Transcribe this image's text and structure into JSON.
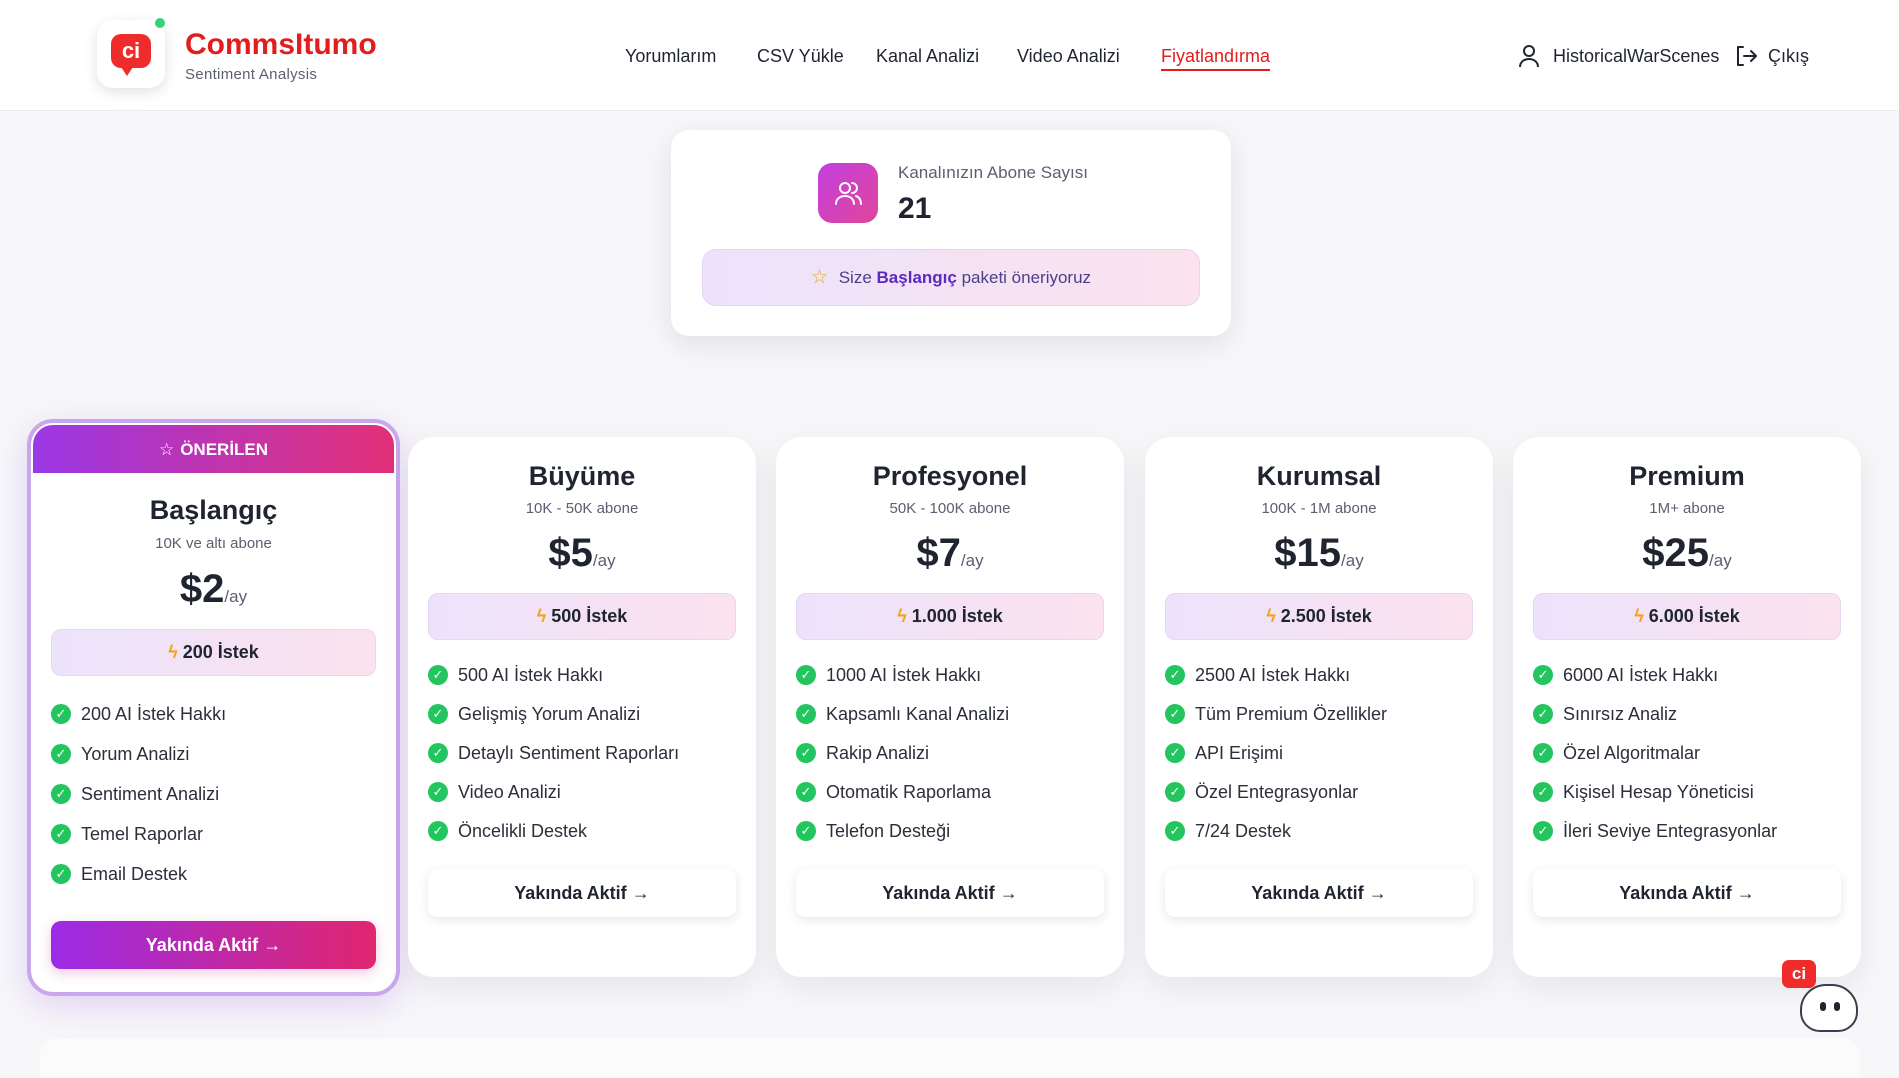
{
  "header": {
    "brand": "CommsItumo",
    "tagline": "Sentiment Analysis",
    "logo_text": "ci",
    "nav": [
      {
        "label": "Yorumlarım"
      },
      {
        "label": "CSV Yükle"
      },
      {
        "label": "Kanal Analizi"
      },
      {
        "label": "Video Analizi"
      },
      {
        "label": "Fiyatlandırma",
        "active": true
      }
    ],
    "user_name": "HistoricalWarScenes",
    "logout_label": "Çıkış"
  },
  "subscriber": {
    "label": "Kanalınızın Abone Sayısı",
    "count": "21",
    "recommend_prefix": "Size",
    "recommend_plan": "Başlangıç",
    "recommend_suffix": "paketi öneriyoruz"
  },
  "plans": [
    {
      "badge": "ÖNERİLEN",
      "name": "Başlangıç",
      "range": "10K ve altı abone",
      "price": "$2",
      "period": "/ay",
      "requests": "200 İstek",
      "features": [
        "200 AI İstek Hakkı",
        "Yorum Analizi",
        "Sentiment Analizi",
        "Temel Raporlar",
        "Email Destek"
      ],
      "cta": "Yakında Aktif"
    },
    {
      "name": "Büyüme",
      "range": "10K - 50K abone",
      "price": "$5",
      "period": "/ay",
      "requests": "500 İstek",
      "features": [
        "500 AI İstek Hakkı",
        "Gelişmiş Yorum Analizi",
        "Detaylı Sentiment Raporları",
        "Video Analizi",
        "Öncelikli Destek"
      ],
      "cta": "Yakında Aktif"
    },
    {
      "name": "Profesyonel",
      "range": "50K - 100K abone",
      "price": "$7",
      "period": "/ay",
      "requests": "1.000 İstek",
      "features": [
        "1000 AI İstek Hakkı",
        "Kapsamlı Kanal Analizi",
        "Rakip Analizi",
        "Otomatik Raporlama",
        "Telefon Desteği"
      ],
      "cta": "Yakında Aktif"
    },
    {
      "name": "Kurumsal",
      "range": "100K - 1M abone",
      "price": "$15",
      "period": "/ay",
      "requests": "2.500 İstek",
      "features": [
        "2500 AI İstek Hakkı",
        "Tüm Premium Özellikler",
        "API Erişimi",
        "Özel Entegrasyonlar",
        "7/24 Destek"
      ],
      "cta": "Yakında Aktif"
    },
    {
      "name": "Premium",
      "range": "1M+ abone",
      "price": "$25",
      "period": "/ay",
      "requests": "6.000 İstek",
      "features": [
        "6000 AI İstek Hakkı",
        "Sınırsız Analiz",
        "Özel Algoritmalar",
        "Kişisel Hesap Yöneticisi",
        "İleri Seviye Entegrasyonlar"
      ],
      "cta": "Yakında Aktif"
    }
  ],
  "mascot_text": "ci",
  "colors": {
    "brand_red": "#e11d1d",
    "accent_purple": "#9b2be6",
    "accent_pink": "#e0266e",
    "check_green": "#22c55e"
  }
}
